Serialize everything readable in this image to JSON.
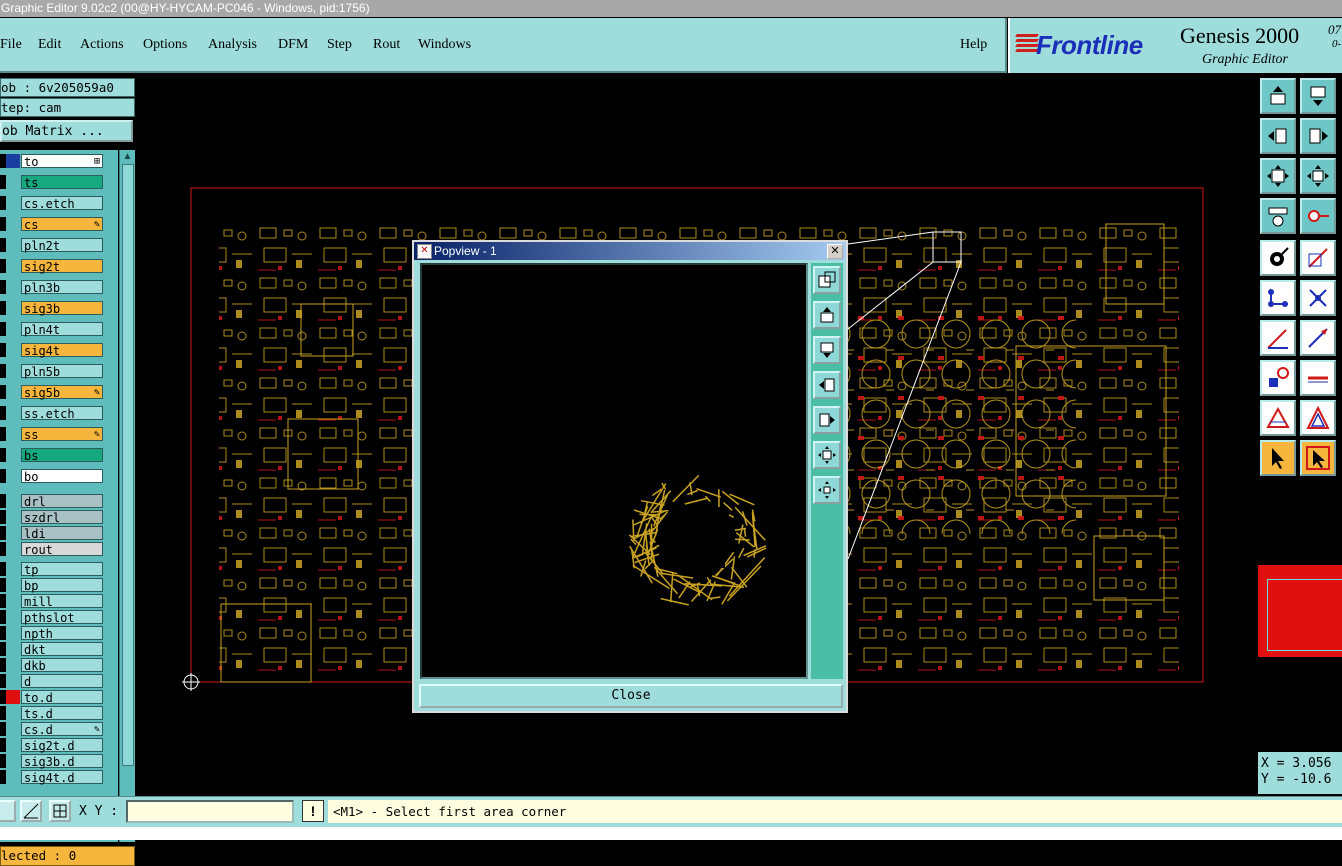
{
  "window": {
    "title": "Graphic Editor 9.02c2 (00@HY-HYCAM-PC046 - Windows, pid:1756)"
  },
  "menu": {
    "items": [
      "File",
      "Edit",
      "Actions",
      "Options",
      "Analysis",
      "DFM",
      "Step",
      "Rout",
      "Windows"
    ],
    "help": "Help"
  },
  "brand": {
    "logo": "Frontline",
    "product": "Genesis 2000",
    "version_top": "07",
    "version_bottom": "0-",
    "subtitle": "Graphic Editor"
  },
  "job": {
    "job_label": "ob : 6v205059a0",
    "step_label": "tep: cam",
    "matrix_button": "ob Matrix ..."
  },
  "layers": [
    {
      "name": "to",
      "bg": "#ffffff",
      "mark": "⊞",
      "swatch": "#1a3fa0"
    },
    {
      "name": "ts",
      "bg": "#16a87e",
      "mark": ""
    },
    {
      "name": "cs.etch",
      "bg": "#9fdcdc",
      "mark": ""
    },
    {
      "name": "cs",
      "bg": "#f6b53c",
      "mark": "✎"
    },
    {
      "name": "pln2t",
      "bg": "#9fdcdc",
      "mark": ""
    },
    {
      "name": "sig2t",
      "bg": "#f6b53c",
      "mark": ""
    },
    {
      "name": "pln3b",
      "bg": "#9fdcdc",
      "mark": ""
    },
    {
      "name": "sig3b",
      "bg": "#f6b53c",
      "mark": ""
    },
    {
      "name": "pln4t",
      "bg": "#9fdcdc",
      "mark": ""
    },
    {
      "name": "sig4t",
      "bg": "#f6b53c",
      "mark": ""
    },
    {
      "name": "pln5b",
      "bg": "#9fdcdc",
      "mark": ""
    },
    {
      "name": "sig5b",
      "bg": "#f6b53c",
      "mark": "✎"
    },
    {
      "name": "ss.etch",
      "bg": "#9fdcdc",
      "mark": ""
    },
    {
      "name": "ss",
      "bg": "#f6b53c",
      "mark": "✎"
    },
    {
      "name": "bs",
      "bg": "#16a87e",
      "mark": ""
    },
    {
      "name": "bo",
      "bg": "#ffffff",
      "mark": ""
    },
    {
      "name": "drl",
      "bg": "#a9c0c4",
      "mark": ""
    },
    {
      "name": "szdrl",
      "bg": "#a9c0c4",
      "mark": ""
    },
    {
      "name": "ldi",
      "bg": "#a9c0c4",
      "mark": ""
    },
    {
      "name": "rout",
      "bg": "#d8d8d8",
      "mark": ""
    },
    {
      "name": "tp",
      "bg": "#9fdcdc",
      "mark": ""
    },
    {
      "name": "bp",
      "bg": "#9fdcdc",
      "mark": ""
    },
    {
      "name": "mill",
      "bg": "#9fdcdc",
      "mark": ""
    },
    {
      "name": "pthslot",
      "bg": "#9fdcdc",
      "mark": ""
    },
    {
      "name": "npth",
      "bg": "#9fdcdc",
      "mark": ""
    },
    {
      "name": "dkt",
      "bg": "#9fdcdc",
      "mark": ""
    },
    {
      "name": "dkb",
      "bg": "#9fdcdc",
      "mark": ""
    },
    {
      "name": "d",
      "bg": "#9fdcdc",
      "mark": ""
    },
    {
      "name": "to.d",
      "bg": "#9fdcdc",
      "mark": "",
      "swatch": "#e01010"
    },
    {
      "name": "ts.d",
      "bg": "#9fdcdc",
      "mark": ""
    },
    {
      "name": "cs.d",
      "bg": "#9fdcdc",
      "mark": "✎"
    },
    {
      "name": "sig2t.d",
      "bg": "#9fdcdc",
      "mark": ""
    },
    {
      "name": "sig3b.d",
      "bg": "#9fdcdc",
      "mark": ""
    },
    {
      "name": "sig4t.d",
      "bg": "#9fdcdc",
      "mark": ""
    }
  ],
  "selected": "lected : 0",
  "coords": {
    "x": "X = 3.056",
    "y": "Y = -10.6"
  },
  "status": {
    "xy_label": "X Y :",
    "xy_value": "",
    "sys_button": "!",
    "prompt": "<M1> - Select first area corner"
  },
  "popview": {
    "title": "Popview - 1",
    "close_label": "Close"
  },
  "colors": {
    "copper": "#c9a222",
    "outline": "#d01818",
    "panel": "#9fdcdc"
  }
}
